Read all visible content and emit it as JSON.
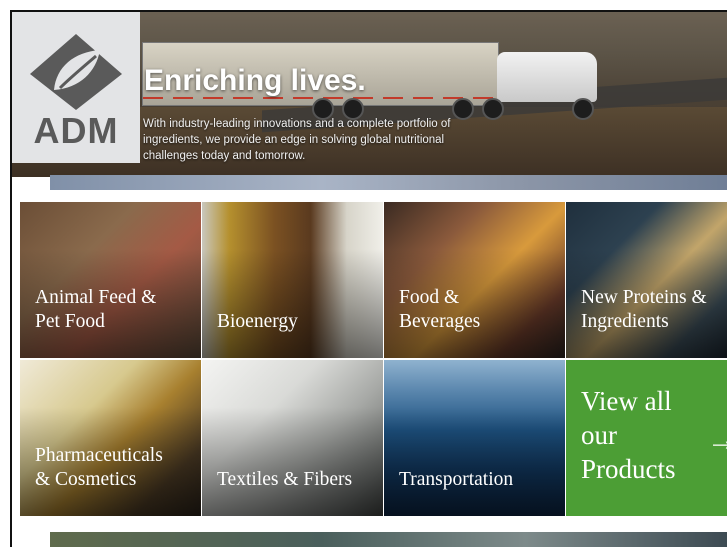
{
  "brand": {
    "name": "ADM"
  },
  "hero": {
    "title": "Enriching lives.",
    "description": "With industry-leading innovations and a complete portfolio of ingredients, we provide an edge in solving global nutritional challenges today and tomorrow."
  },
  "tiles": [
    {
      "label_line1": "Animal Feed &",
      "label_line2": "Pet Food"
    },
    {
      "label_line1": "Bioenergy",
      "label_line2": ""
    },
    {
      "label_line1": "Food &",
      "label_line2": "Beverages"
    },
    {
      "label_line1": "New Proteins &",
      "label_line2": "Ingredients"
    },
    {
      "label_line1": "Pharmaceuticals",
      "label_line2": "& Cosmetics"
    },
    {
      "label_line1": "Textiles & Fibers",
      "label_line2": ""
    },
    {
      "label_line1": "Transportation",
      "label_line2": ""
    }
  ],
  "view_all": {
    "line1": "View all",
    "line2": "our",
    "line3": "Products",
    "arrow": "→"
  },
  "colors": {
    "accent_green": "#4c9e35",
    "logo_gray": "#5a5a5a"
  }
}
